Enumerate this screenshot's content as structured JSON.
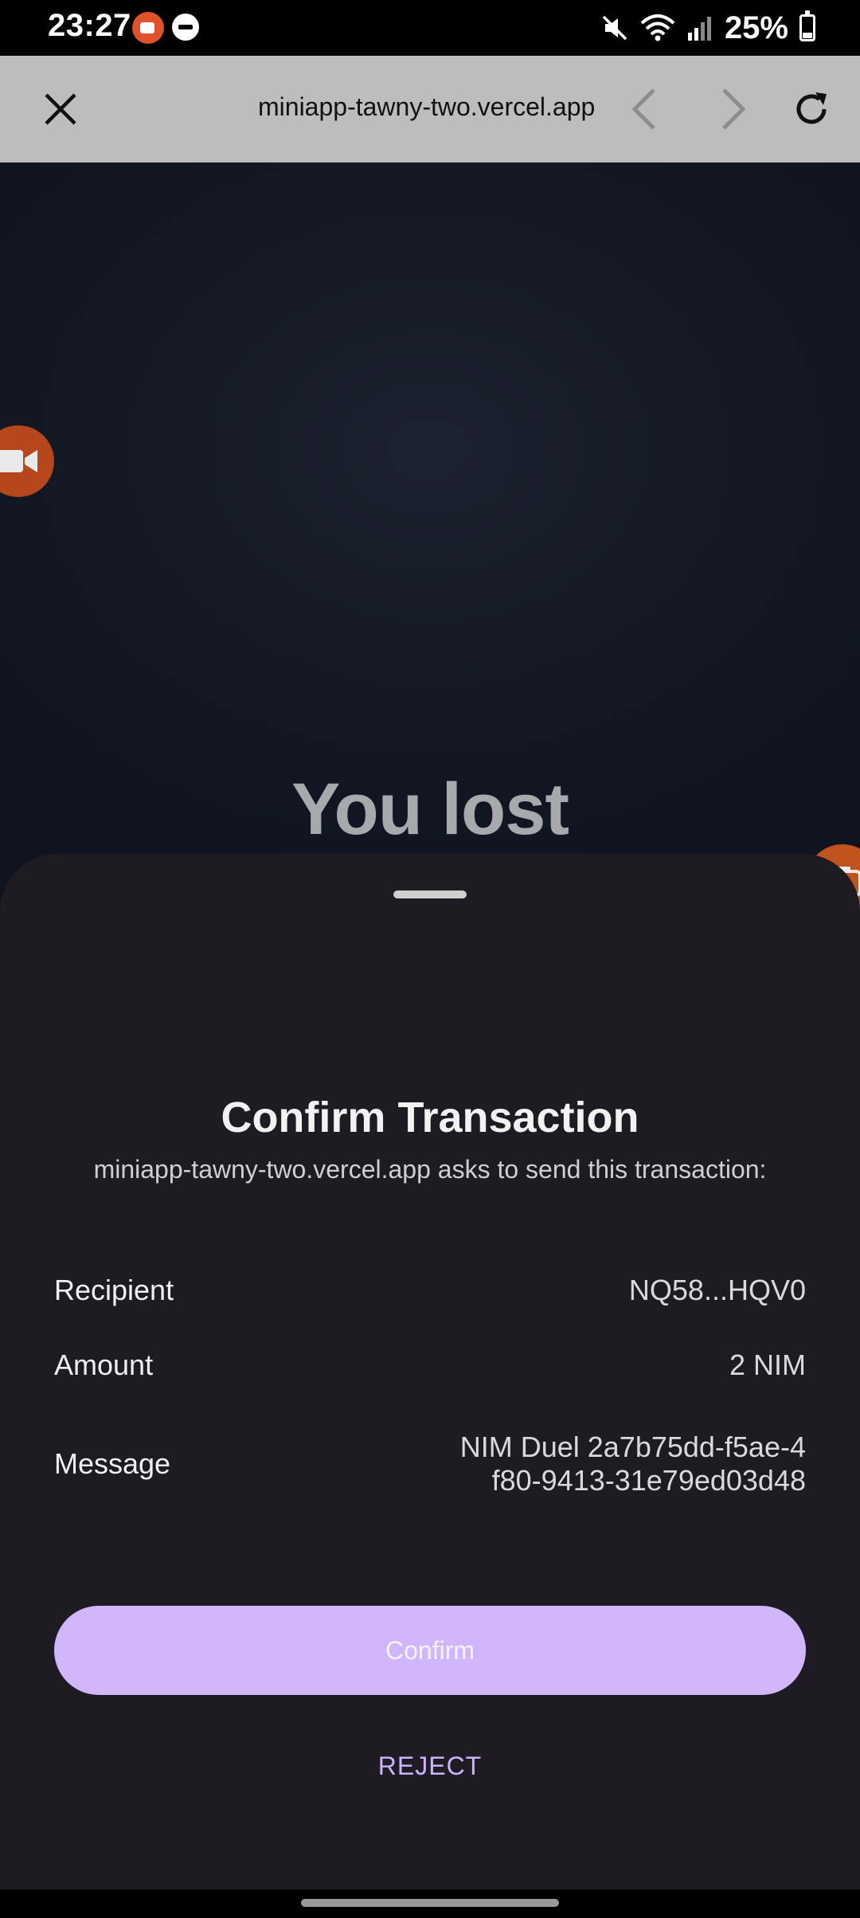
{
  "status_bar": {
    "time": "23:27",
    "battery": "25%",
    "icons": [
      "screen-record-icon",
      "do-not-disturb-icon",
      "mute-icon",
      "wifi-icon",
      "signal-icon",
      "battery-icon"
    ]
  },
  "browser": {
    "url": "miniapp-tawny-two.vercel.app",
    "icons": [
      "close-icon",
      "back-arrow-icon",
      "forward-arrow-icon",
      "reload-icon"
    ]
  },
  "page": {
    "headline": "You lost"
  },
  "sheet": {
    "title": "Confirm Transaction",
    "subtitle": "miniapp-tawny-two.vercel.app asks to send this transaction:",
    "rows": [
      {
        "label": "Recipient",
        "value": "NQ58...HQV0"
      },
      {
        "label": "Amount",
        "value": "2 NIM"
      },
      {
        "label": "Message",
        "value_line1": "NIM Duel 2a7b75dd-f5ae-4",
        "value_line2": "f80-9413-31e79ed03d48"
      }
    ],
    "confirm_label": "Confirm",
    "reject_label": "REJECT"
  },
  "colors": {
    "accent": "#d1b6fb",
    "reject_text": "#cbb4ff",
    "sheet_bg": "#1f1b22",
    "browser_bar": "#bdbdbd",
    "float_button": "#c0541f"
  }
}
